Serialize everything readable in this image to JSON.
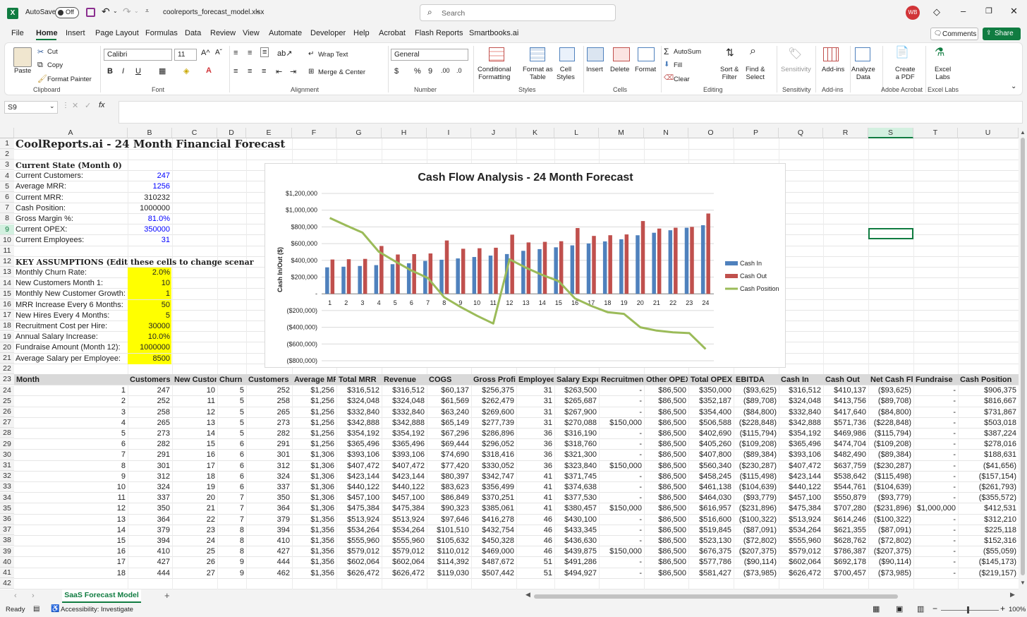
{
  "titlebar": {
    "autosave": "AutoSave",
    "autosave_state": "Off",
    "filename": "coolreports_forecast_model.xlsx",
    "search_placeholder": "Search",
    "avatar": "WB"
  },
  "menu_tabs": [
    "File",
    "Home",
    "Insert",
    "Page Layout",
    "Formulas",
    "Data",
    "Review",
    "View",
    "Automate",
    "Developer",
    "Help",
    "Acrobat",
    "Flash Reports",
    "Smartbooks.ai"
  ],
  "active_tab": "Home",
  "comments_label": "Comments",
  "share_label": "Share",
  "ribbon": {
    "clipboard": {
      "paste": "Paste",
      "cut": "Cut",
      "copy": "Copy",
      "format_painter": "Format Painter",
      "group": "Clipboard"
    },
    "font": {
      "name": "Calibri",
      "size": "11",
      "group": "Font"
    },
    "alignment": {
      "wrap": "Wrap Text",
      "merge": "Merge & Center",
      "group": "Alignment"
    },
    "number": {
      "format": "General",
      "group": "Number"
    },
    "styles": {
      "cond": [
        "Conditional",
        "Formatting"
      ],
      "table": [
        "Format as",
        "Table"
      ],
      "cell": [
        "Cell",
        "Styles"
      ],
      "group": "Styles"
    },
    "cells": {
      "insert": "Insert",
      "delete": "Delete",
      "format": "Format",
      "group": "Cells"
    },
    "editing": {
      "autosum": "AutoSum",
      "fill": "Fill",
      "clear": "Clear",
      "sort": [
        "Sort &",
        "Filter"
      ],
      "find": [
        "Find &",
        "Select"
      ],
      "group": "Editing"
    },
    "sensitivity": {
      "label": "Sensitivity",
      "group": "Sensitivity"
    },
    "addins": {
      "label": "Add-ins",
      "group": "Add-ins"
    },
    "analyze": [
      "Analyze",
      "Data"
    ],
    "pdf": {
      "label": [
        "Create",
        "a PDF"
      ],
      "group": "Adobe Acrobat"
    },
    "labs": {
      "label": [
        "Excel",
        "Labs"
      ],
      "group": "Excel Labs"
    }
  },
  "namebox": "S9",
  "fx": "fx",
  "columns": [
    "A",
    "B",
    "C",
    "D",
    "E",
    "F",
    "G",
    "H",
    "I",
    "J",
    "K",
    "L",
    "M",
    "N",
    "O",
    "P",
    "Q",
    "R",
    "S",
    "T",
    "U"
  ],
  "rows": [
    "1",
    "2",
    "3",
    "4",
    "5",
    "6",
    "7",
    "8",
    "9",
    "10",
    "11",
    "12",
    "13",
    "14",
    "15",
    "16",
    "17",
    "18",
    "19",
    "20",
    "21",
    "22",
    "23",
    "24",
    "25",
    "26",
    "27",
    "28",
    "29",
    "30",
    "31",
    "32",
    "33",
    "34",
    "35",
    "36",
    "37",
    "38",
    "39",
    "40",
    "41",
    "42"
  ],
  "sheet": {
    "title": "CoolReports.ai - 24 Month Financial Forecast",
    "current_state": "Current State (Month 0)",
    "state": [
      [
        "Current Customers:",
        "247"
      ],
      [
        "Average MRR:",
        "1256"
      ],
      [
        "Current MRR:",
        "310232"
      ],
      [
        "Cash Position:",
        "1000000"
      ],
      [
        "Gross Margin %:",
        "81.0%"
      ],
      [
        "Current OPEX:",
        "350000"
      ],
      [
        "Current Employees:",
        "31"
      ]
    ],
    "assumptions_title": "KEY ASSUMPTIONS (Edit these cells to change scenarios)",
    "assumptions": [
      [
        "Monthly Churn Rate:",
        "2.0%"
      ],
      [
        "New Customers Month 1:",
        "10"
      ],
      [
        "Monthly New Customer Growth:",
        "1"
      ],
      [
        "MRR Increase Every 6 Months:",
        "50"
      ],
      [
        "New Hires Every 4 Months:",
        "5"
      ],
      [
        "Recruitment Cost per Hire:",
        "30000"
      ],
      [
        "Annual Salary Increase:",
        "10.0%"
      ],
      [
        "Fundraise Amount (Month 12):",
        "1000000"
      ],
      [
        "Average Salary per Employee:",
        "8500"
      ]
    ],
    "headers": [
      "Month",
      "Customers (",
      "New Custom",
      "Churn",
      "Customers E",
      "Average MR",
      "Total MRR",
      "Revenue",
      "COGS",
      "Gross Profit",
      "Employees",
      "Salary Expe",
      "Recruitmen",
      "Other OPEX",
      "Total OPEX",
      "EBITDA",
      "Cash In",
      "Cash Out",
      "Net Cash Flo",
      "Fundraise",
      "Cash Position"
    ],
    "data": [
      [
        "1",
        "247",
        "10",
        "5",
        "252",
        "$1,256",
        "$316,512",
        "$316,512",
        "$60,137",
        "$256,375",
        "31",
        "$263,500",
        "-",
        "$86,500",
        "$350,000",
        "($93,625)",
        "$316,512",
        "$410,137",
        "($93,625)",
        "-",
        "$906,375"
      ],
      [
        "2",
        "252",
        "11",
        "5",
        "258",
        "$1,256",
        "$324,048",
        "$324,048",
        "$61,569",
        "$262,479",
        "31",
        "$265,687",
        "-",
        "$86,500",
        "$352,187",
        "($89,708)",
        "$324,048",
        "$413,756",
        "($89,708)",
        "-",
        "$816,667"
      ],
      [
        "3",
        "258",
        "12",
        "5",
        "265",
        "$1,256",
        "$332,840",
        "$332,840",
        "$63,240",
        "$269,600",
        "31",
        "$267,900",
        "-",
        "$86,500",
        "$354,400",
        "($84,800)",
        "$332,840",
        "$417,640",
        "($84,800)",
        "-",
        "$731,867"
      ],
      [
        "4",
        "265",
        "13",
        "5",
        "273",
        "$1,256",
        "$342,888",
        "$342,888",
        "$65,149",
        "$277,739",
        "31",
        "$270,088",
        "$150,000",
        "$86,500",
        "$506,588",
        "($228,848)",
        "$342,888",
        "$571,736",
        "($228,848)",
        "-",
        "$503,018"
      ],
      [
        "5",
        "273",
        "14",
        "5",
        "282",
        "$1,256",
        "$354,192",
        "$354,192",
        "$67,296",
        "$286,896",
        "36",
        "$316,190",
        "-",
        "$86,500",
        "$402,690",
        "($115,794)",
        "$354,192",
        "$469,986",
        "($115,794)",
        "-",
        "$387,224"
      ],
      [
        "6",
        "282",
        "15",
        "6",
        "291",
        "$1,256",
        "$365,496",
        "$365,496",
        "$69,444",
        "$296,052",
        "36",
        "$318,760",
        "-",
        "$86,500",
        "$405,260",
        "($109,208)",
        "$365,496",
        "$474,704",
        "($109,208)",
        "-",
        "$278,016"
      ],
      [
        "7",
        "291",
        "16",
        "6",
        "301",
        "$1,306",
        "$393,106",
        "$393,106",
        "$74,690",
        "$318,416",
        "36",
        "$321,300",
        "-",
        "$86,500",
        "$407,800",
        "($89,384)",
        "$393,106",
        "$482,490",
        "($89,384)",
        "-",
        "$188,631"
      ],
      [
        "8",
        "301",
        "17",
        "6",
        "312",
        "$1,306",
        "$407,472",
        "$407,472",
        "$77,420",
        "$330,052",
        "36",
        "$323,840",
        "$150,000",
        "$86,500",
        "$560,340",
        "($230,287)",
        "$407,472",
        "$637,759",
        "($230,287)",
        "-",
        "($41,656)"
      ],
      [
        "9",
        "312",
        "18",
        "6",
        "324",
        "$1,306",
        "$423,144",
        "$423,144",
        "$80,397",
        "$342,747",
        "41",
        "$371,745",
        "-",
        "$86,500",
        "$458,245",
        "($115,498)",
        "$423,144",
        "$538,642",
        "($115,498)",
        "-",
        "($157,154)"
      ],
      [
        "10",
        "324",
        "19",
        "6",
        "337",
        "$1,306",
        "$440,122",
        "$440,122",
        "$83,623",
        "$356,499",
        "41",
        "$374,638",
        "-",
        "$86,500",
        "$461,138",
        "($104,639)",
        "$440,122",
        "$544,761",
        "($104,639)",
        "-",
        "($261,793)"
      ],
      [
        "11",
        "337",
        "20",
        "7",
        "350",
        "$1,306",
        "$457,100",
        "$457,100",
        "$86,849",
        "$370,251",
        "41",
        "$377,530",
        "-",
        "$86,500",
        "$464,030",
        "($93,779)",
        "$457,100",
        "$550,879",
        "($93,779)",
        "-",
        "($355,572)"
      ],
      [
        "12",
        "350",
        "21",
        "7",
        "364",
        "$1,306",
        "$475,384",
        "$475,384",
        "$90,323",
        "$385,061",
        "41",
        "$380,457",
        "$150,000",
        "$86,500",
        "$616,957",
        "($231,896)",
        "$475,384",
        "$707,280",
        "($231,896)",
        "$1,000,000",
        "$412,531"
      ],
      [
        "13",
        "364",
        "22",
        "7",
        "379",
        "$1,356",
        "$513,924",
        "$513,924",
        "$97,646",
        "$416,278",
        "46",
        "$430,100",
        "-",
        "$86,500",
        "$516,600",
        "($100,322)",
        "$513,924",
        "$614,246",
        "($100,322)",
        "-",
        "$312,210"
      ],
      [
        "14",
        "379",
        "23",
        "8",
        "394",
        "$1,356",
        "$534,264",
        "$534,264",
        "$101,510",
        "$432,754",
        "46",
        "$433,345",
        "-",
        "$86,500",
        "$519,845",
        "($87,091)",
        "$534,264",
        "$621,355",
        "($87,091)",
        "-",
        "$225,118"
      ],
      [
        "15",
        "394",
        "24",
        "8",
        "410",
        "$1,356",
        "$555,960",
        "$555,960",
        "$105,632",
        "$450,328",
        "46",
        "$436,630",
        "-",
        "$86,500",
        "$523,130",
        "($72,802)",
        "$555,960",
        "$628,762",
        "($72,802)",
        "-",
        "$152,316"
      ],
      [
        "16",
        "410",
        "25",
        "8",
        "427",
        "$1,356",
        "$579,012",
        "$579,012",
        "$110,012",
        "$469,000",
        "46",
        "$439,875",
        "$150,000",
        "$86,500",
        "$676,375",
        "($207,375)",
        "$579,012",
        "$786,387",
        "($207,375)",
        "-",
        "($55,059)"
      ],
      [
        "17",
        "427",
        "26",
        "9",
        "444",
        "$1,356",
        "$602,064",
        "$602,064",
        "$114,392",
        "$487,672",
        "51",
        "$491,286",
        "-",
        "$86,500",
        "$577,786",
        "($90,114)",
        "$602,064",
        "$692,178",
        "($90,114)",
        "-",
        "($145,173)"
      ],
      [
        "18",
        "444",
        "27",
        "9",
        "462",
        "$1,356",
        "$626,472",
        "$626,472",
        "$119,030",
        "$507,442",
        "51",
        "$494,927",
        "-",
        "$86,500",
        "$581,427",
        "($73,985)",
        "$626,472",
        "$700,457",
        "($73,985)",
        "-",
        "($219,157)"
      ]
    ]
  },
  "chart_data": {
    "type": "bar",
    "title": "Cash Flow Analysis - 24 Month Forecast",
    "ylabel": "Cash In/Out ($)",
    "xlabel": "",
    "categories": [
      "1",
      "2",
      "3",
      "4",
      "5",
      "6",
      "7",
      "8",
      "9",
      "10",
      "11",
      "12",
      "13",
      "14",
      "15",
      "16",
      "17",
      "18",
      "19",
      "20",
      "21",
      "22",
      "23",
      "24"
    ],
    "ylim": [
      -800000,
      1200000
    ],
    "yticks": [
      "$1,200,000",
      "$1,000,000",
      "$800,000",
      "$600,000",
      "$400,000",
      "$200,000",
      "-",
      "($200,000)",
      "($400,000)",
      "($600,000)",
      "($800,000)"
    ],
    "legend_position": "right",
    "series": [
      {
        "name": "Cash In",
        "kind": "bar",
        "color": "#4f81bd",
        "values": [
          316512,
          324048,
          332840,
          342888,
          354192,
          365496,
          393106,
          407472,
          423144,
          440122,
          457100,
          475384,
          513924,
          534264,
          555960,
          579012,
          602064,
          626472,
          652000,
          700000,
          730000,
          760000,
          790000,
          820000
        ]
      },
      {
        "name": "Cash Out",
        "kind": "bar",
        "color": "#c0504d",
        "values": [
          410137,
          413756,
          417640,
          571736,
          469986,
          474704,
          482490,
          637759,
          538642,
          544761,
          550879,
          707280,
          614246,
          621355,
          628762,
          786387,
          692178,
          700457,
          710000,
          870000,
          780000,
          790000,
          800000,
          960000
        ]
      },
      {
        "name": "Cash Position",
        "kind": "line",
        "color": "#9bbb59",
        "values": [
          906375,
          816667,
          731867,
          503018,
          387224,
          278016,
          188631,
          -41656,
          -157154,
          -261793,
          -355572,
          412531,
          312210,
          225118,
          152316,
          -55059,
          -145173,
          -219157,
          -240000,
          -400000,
          -440000,
          -460000,
          -470000,
          -660000
        ]
      }
    ]
  },
  "sheet_tab": "SaaS Forecast Model",
  "status": {
    "ready": "Ready",
    "accessibility": "Accessibility: Investigate",
    "zoom": "100%"
  }
}
